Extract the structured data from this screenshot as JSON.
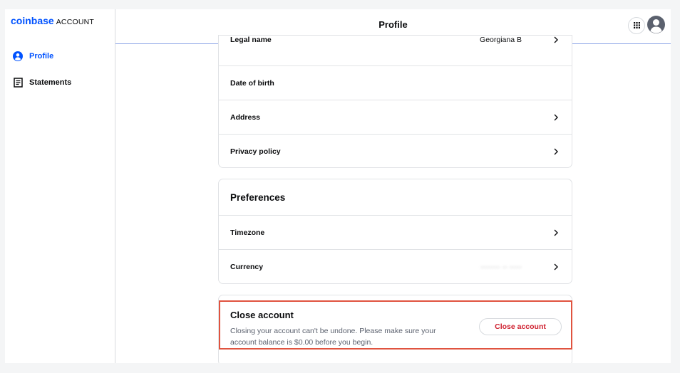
{
  "app": {
    "brand": "coinbase",
    "section": "ACCOUNT"
  },
  "sidebar": {
    "items": [
      {
        "label": "Profile",
        "icon": "user-circle-icon",
        "active": true
      },
      {
        "label": "Statements",
        "icon": "document-icon",
        "active": false
      }
    ]
  },
  "header": {
    "title": "Profile",
    "apps_icon": "grid-icon",
    "avatar_icon": "user-avatar-icon"
  },
  "personal_info": {
    "rows": [
      {
        "label": "Legal name",
        "value": "Georgiana B"
      },
      {
        "label": "Date of birth",
        "value": ""
      },
      {
        "label": "Address",
        "value": ""
      },
      {
        "label": "Privacy policy",
        "value": ""
      }
    ]
  },
  "preferences": {
    "title": "Preferences",
    "rows": [
      {
        "label": "Timezone",
        "value": ""
      },
      {
        "label": "Currency",
        "value": "blurred"
      }
    ]
  },
  "close_account": {
    "title": "Close account",
    "description": "Closing your account can't be undone. Please make sure your account balance is $0.00 before you begin.",
    "button_label": "Close account"
  },
  "colors": {
    "brand_blue": "#0052ff",
    "danger_red": "#cf202f",
    "highlight": "#e0533f"
  }
}
